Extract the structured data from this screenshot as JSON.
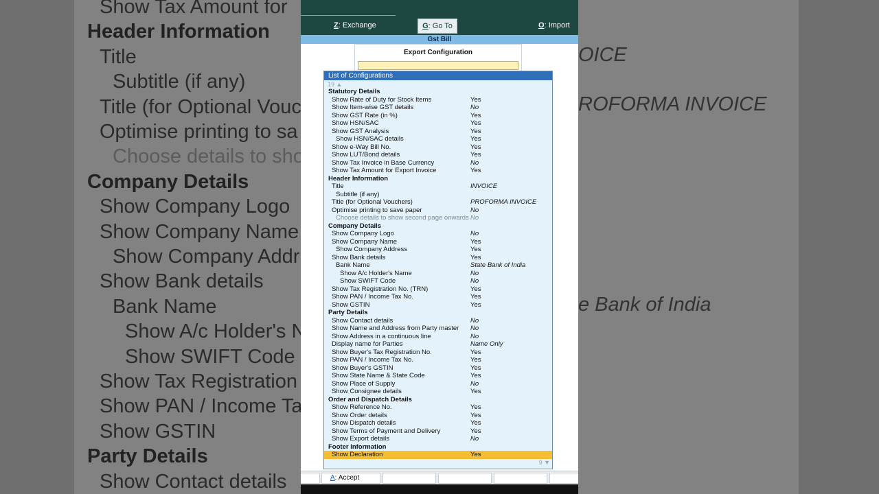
{
  "background": {
    "lines": [
      {
        "text": "Show Tax Amount for",
        "style": ""
      },
      {
        "text": "Header Information",
        "style": "b"
      },
      {
        "text": "Title",
        "style": ""
      },
      {
        "text": "Subtitle (if any)",
        "style": ""
      },
      {
        "text": "Title (for Optional Vouc",
        "style": ""
      },
      {
        "text": "Optimise printing to sa",
        "style": ""
      },
      {
        "text": "Choose details to sho",
        "style": "dim"
      },
      {
        "text": "Company Details",
        "style": "b"
      },
      {
        "text": "Show Company Logo",
        "style": ""
      },
      {
        "text": "Show Company Name",
        "style": ""
      },
      {
        "text": "Show Company Addr",
        "style": ""
      },
      {
        "text": "Show Bank details",
        "style": ""
      },
      {
        "text": "Bank Name",
        "style": ""
      },
      {
        "text": "Show A/c Holder's N",
        "style": ""
      },
      {
        "text": "Show SWIFT Code",
        "style": ""
      },
      {
        "text": "Show Tax Registration",
        "style": ""
      },
      {
        "text": "Show PAN / Income Ta",
        "style": ""
      },
      {
        "text": "Show GSTIN",
        "style": ""
      },
      {
        "text": "Party Details",
        "style": "b"
      },
      {
        "text": "Show Contact details",
        "style": ""
      }
    ],
    "right_texts": [
      "OICE",
      "ROFORMA INVOICE",
      "e Bank of India"
    ]
  },
  "toolbar": {
    "exchange": {
      "key": "Z",
      "label": "Exchange"
    },
    "goto": {
      "key": "G",
      "label": "Go To"
    },
    "import": {
      "key": "O",
      "label": "Import"
    }
  },
  "window_title": "Gst Bill",
  "export_config": {
    "title": "Export Configuration",
    "value": ""
  },
  "list": {
    "title": "List of Configurations",
    "count_top": "19 ▲",
    "count_bottom": "9 ▼",
    "rows": [
      {
        "label": "Statutory Details",
        "value": "",
        "kind": "section"
      },
      {
        "label": "Show Rate of Duty for Stock Items",
        "value": "Yes",
        "kind": "l1"
      },
      {
        "label": "Show Item-wise GST details",
        "value": "No",
        "kind": "l1",
        "italic": true
      },
      {
        "label": "Show GST Rate (in %)",
        "value": "Yes",
        "kind": "l1"
      },
      {
        "label": "Show HSN/SAC",
        "value": "Yes",
        "kind": "l1"
      },
      {
        "label": "Show GST Analysis",
        "value": "Yes",
        "kind": "l1"
      },
      {
        "label": "Show HSN/SAC details",
        "value": "Yes",
        "kind": "l2"
      },
      {
        "label": "Show e-Way Bill No.",
        "value": "Yes",
        "kind": "l1"
      },
      {
        "label": "Show LUT/Bond details",
        "value": "Yes",
        "kind": "l1"
      },
      {
        "label": "Show Tax Invoice in Base Currency",
        "value": "No",
        "kind": "l1",
        "italic": true
      },
      {
        "label": "Show Tax Amount for Export Invoice",
        "value": "Yes",
        "kind": "l1"
      },
      {
        "label": "Header Information",
        "value": "",
        "kind": "section"
      },
      {
        "label": "Title",
        "value": "INVOICE",
        "kind": "l1",
        "italic": true
      },
      {
        "label": "Subtitle (if any)",
        "value": "",
        "kind": "l2"
      },
      {
        "label": "Title (for Optional Vouchers)",
        "value": "PROFORMA INVOICE",
        "kind": "l1",
        "italic": true
      },
      {
        "label": "Optimise printing to save paper",
        "value": "No",
        "kind": "l1",
        "italic": true
      },
      {
        "label": "Choose details to show second page onwards",
        "value": "No",
        "kind": "l2",
        "italic": true,
        "dim": true
      },
      {
        "label": "Company Details",
        "value": "",
        "kind": "section"
      },
      {
        "label": "Show Company Logo",
        "value": "No",
        "kind": "l1",
        "italic": true
      },
      {
        "label": "Show Company Name",
        "value": "Yes",
        "kind": "l1"
      },
      {
        "label": "Show Company Address",
        "value": "Yes",
        "kind": "l2"
      },
      {
        "label": "Show Bank details",
        "value": "Yes",
        "kind": "l1"
      },
      {
        "label": "Bank Name",
        "value": "State Bank of India",
        "kind": "l2",
        "italic": true
      },
      {
        "label": "Show A/c Holder's Name",
        "value": "No",
        "kind": "l3",
        "italic": true
      },
      {
        "label": "Show SWIFT Code",
        "value": "No",
        "kind": "l3",
        "italic": true
      },
      {
        "label": "Show Tax Registration No. (TRN)",
        "value": "Yes",
        "kind": "l1"
      },
      {
        "label": "Show PAN / Income Tax No.",
        "value": "Yes",
        "kind": "l1"
      },
      {
        "label": "Show GSTIN",
        "value": "Yes",
        "kind": "l1"
      },
      {
        "label": "Party Details",
        "value": "",
        "kind": "section"
      },
      {
        "label": "Show Contact details",
        "value": "No",
        "kind": "l1",
        "italic": true
      },
      {
        "label": "Show Name and Address from Party master",
        "value": "No",
        "kind": "l1",
        "italic": true
      },
      {
        "label": "Show Address in a continuous line",
        "value": "No",
        "kind": "l1",
        "italic": true
      },
      {
        "label": "Display name for Parties",
        "value": "Name Only",
        "kind": "l1",
        "italic": true
      },
      {
        "label": "Show Buyer's Tax Registration No.",
        "value": "Yes",
        "kind": "l1"
      },
      {
        "label": "Show PAN / Income Tax No.",
        "value": "Yes",
        "kind": "l1"
      },
      {
        "label": "Show Buyer's GSTIN",
        "value": "Yes",
        "kind": "l1"
      },
      {
        "label": "Show State Name & State Code",
        "value": "Yes",
        "kind": "l1"
      },
      {
        "label": "Show Place of Supply",
        "value": "No",
        "kind": "l1",
        "italic": true
      },
      {
        "label": "Show Consignee details",
        "value": "Yes",
        "kind": "l1"
      },
      {
        "label": "Order and Dispatch Details",
        "value": "",
        "kind": "section"
      },
      {
        "label": "Show Reference No.",
        "value": "Yes",
        "kind": "l1"
      },
      {
        "label": "Show Order details",
        "value": "Yes",
        "kind": "l1"
      },
      {
        "label": "Show Dispatch details",
        "value": "Yes",
        "kind": "l1"
      },
      {
        "label": "Show Terms of Payment and Delivery",
        "value": "Yes",
        "kind": "l1"
      },
      {
        "label": "Show Export details",
        "value": "No",
        "kind": "l1",
        "italic": true
      },
      {
        "label": "Footer Information",
        "value": "",
        "kind": "section"
      },
      {
        "label": "Show Declaration",
        "value": "Yes",
        "kind": "l1",
        "selected": true
      }
    ]
  },
  "bottom": {
    "accept": {
      "key": "A",
      "label": "Accept"
    }
  },
  "colors": {
    "topbar": "#1f4741",
    "title_bar": "#7fb9e6",
    "list_header": "#2f6fb9",
    "list_bg": "#e4f3fb",
    "selection": "#f5bd32",
    "input_bg": "#fdf2b8"
  }
}
